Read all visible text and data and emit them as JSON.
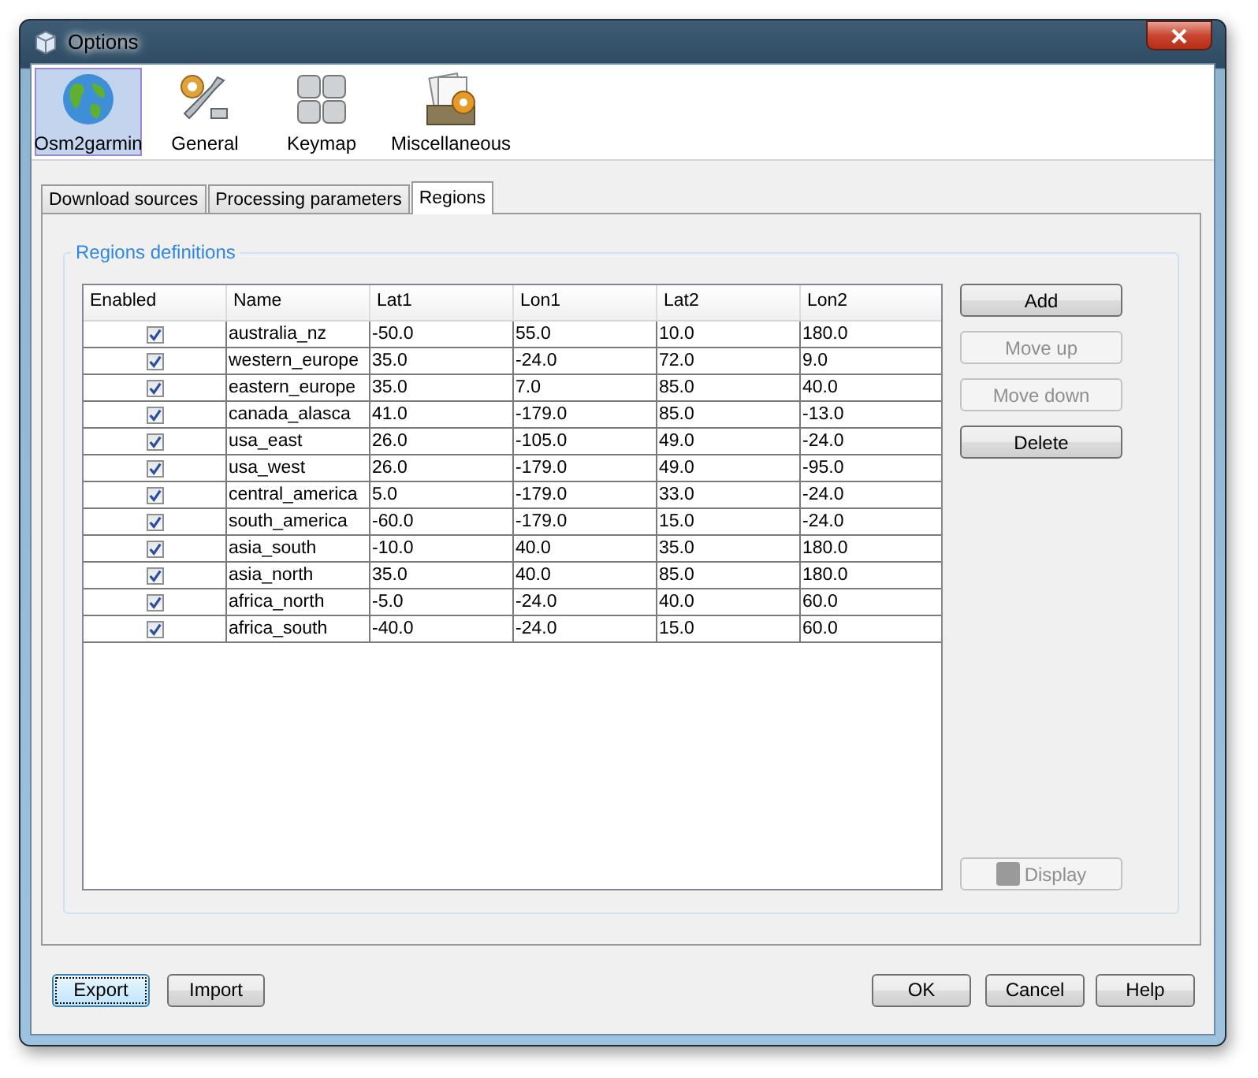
{
  "window": {
    "title": "Options"
  },
  "categories": [
    {
      "label": "Osm2garmin",
      "selected": true
    },
    {
      "label": "General",
      "selected": false
    },
    {
      "label": "Keymap",
      "selected": false
    },
    {
      "label": "Miscellaneous",
      "selected": false
    }
  ],
  "tabs": [
    {
      "label": "Download sources",
      "selected": false
    },
    {
      "label": "Processing parameters",
      "selected": false
    },
    {
      "label": "Regions",
      "selected": true
    }
  ],
  "group": {
    "title": "Regions definitions"
  },
  "table": {
    "check_column": "Enabled",
    "columns": [
      "Name",
      "Lat1",
      "Lon1",
      "Lat2",
      "Lon2"
    ],
    "rows": [
      {
        "enabled": true,
        "cells": [
          "australia_nz",
          "-50.0",
          "55.0",
          "10.0",
          "180.0"
        ]
      },
      {
        "enabled": true,
        "cells": [
          "western_europe",
          "35.0",
          "-24.0",
          "72.0",
          "9.0"
        ]
      },
      {
        "enabled": true,
        "cells": [
          "eastern_europe",
          "35.0",
          "7.0",
          "85.0",
          "40.0"
        ]
      },
      {
        "enabled": true,
        "cells": [
          "canada_alasca",
          "41.0",
          "-179.0",
          "85.0",
          "-13.0"
        ]
      },
      {
        "enabled": true,
        "cells": [
          "usa_east",
          "26.0",
          "-105.0",
          "49.0",
          "-24.0"
        ]
      },
      {
        "enabled": true,
        "cells": [
          "usa_west",
          "26.0",
          "-179.0",
          "49.0",
          "-95.0"
        ]
      },
      {
        "enabled": true,
        "cells": [
          "central_america",
          "5.0",
          "-179.0",
          "33.0",
          "-24.0"
        ]
      },
      {
        "enabled": true,
        "cells": [
          "south_america",
          "-60.0",
          "-179.0",
          "15.0",
          "-24.0"
        ]
      },
      {
        "enabled": true,
        "cells": [
          "asia_south",
          "-10.0",
          "40.0",
          "35.0",
          "180.0"
        ]
      },
      {
        "enabled": true,
        "cells": [
          "asia_north",
          "35.0",
          "40.0",
          "85.0",
          "180.0"
        ]
      },
      {
        "enabled": true,
        "cells": [
          "africa_north",
          "-5.0",
          "-24.0",
          "40.0",
          "60.0"
        ]
      },
      {
        "enabled": true,
        "cells": [
          "africa_south",
          "-40.0",
          "-24.0",
          "15.0",
          "60.0"
        ]
      }
    ]
  },
  "side_buttons": [
    {
      "label": "Add",
      "disabled": false
    },
    {
      "label": "Move up",
      "disabled": true
    },
    {
      "label": "Move down",
      "disabled": true
    },
    {
      "label": "Delete",
      "disabled": false
    }
  ],
  "display_button": {
    "label": "Display",
    "disabled": true
  },
  "footer_left": [
    {
      "label": "Export",
      "focused": true
    },
    {
      "label": "Import",
      "focused": false
    }
  ],
  "footer_right": [
    {
      "label": "OK",
      "focused": false
    },
    {
      "label": "Cancel",
      "focused": false
    },
    {
      "label": "Help",
      "focused": false
    }
  ]
}
